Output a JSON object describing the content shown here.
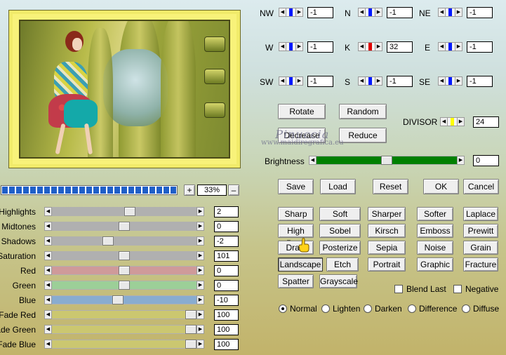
{
  "matrix": {
    "cells": [
      {
        "label": "NW",
        "value": "-1",
        "thumb_color": "#0018ff"
      },
      {
        "label": "N",
        "value": "-1",
        "thumb_color": "#0018ff"
      },
      {
        "label": "NE",
        "value": "-1",
        "thumb_color": "#0018ff"
      },
      {
        "label": "W",
        "value": "-1",
        "thumb_color": "#0018ff"
      },
      {
        "label": "K",
        "value": "32",
        "thumb_color": "#e00000"
      },
      {
        "label": "E",
        "value": "-1",
        "thumb_color": "#0018ff"
      },
      {
        "label": "SW",
        "value": "-1",
        "thumb_color": "#0018ff"
      },
      {
        "label": "S",
        "value": "-1",
        "thumb_color": "#0018ff"
      },
      {
        "label": "SE",
        "value": "-1",
        "thumb_color": "#0018ff"
      }
    ],
    "divisor_label": "DIVISOR",
    "divisor_value": "24",
    "divisor_thumb_color": "#ffff00",
    "rotate": "Rotate",
    "random": "Random",
    "decrease": "Decrease",
    "reduce": "Reduce"
  },
  "brightness": {
    "label": "Brightness",
    "value": "0",
    "level_fraction": 0.5,
    "track_color": "#008000"
  },
  "zoom": {
    "value": "33%",
    "plus": "+",
    "minus": "–",
    "progress_fraction": 1.0
  },
  "actions": {
    "save": "Save",
    "load": "Load",
    "reset": "Reset",
    "ok": "OK",
    "cancel": "Cancel"
  },
  "adjustments": [
    {
      "label": "Highlights",
      "value": "2",
      "level": 0.54,
      "color": "#b0b0b0"
    },
    {
      "label": "Midtones",
      "value": "0",
      "level": 0.5,
      "color": "#b0b0b0"
    },
    {
      "label": "Shadows",
      "value": "-2",
      "level": 0.38,
      "color": "#b0b0b0"
    },
    {
      "label": "Saturation",
      "value": "101",
      "level": 0.5,
      "color": "#b0b0b0"
    },
    {
      "label": "Red",
      "value": "0",
      "level": 0.5,
      "color": "#cf9a9a"
    },
    {
      "label": "Green",
      "value": "0",
      "level": 0.5,
      "color": "#9ccf98"
    },
    {
      "label": "Blue",
      "value": "-10",
      "level": 0.45,
      "color": "#89acd0"
    },
    {
      "label": "Fade Red",
      "value": "100",
      "level": 1.0,
      "color": "#cbc770"
    },
    {
      "label": "Fade Green",
      "value": "100",
      "level": 1.0,
      "color": "#cbc770"
    },
    {
      "label": "Fade Blue",
      "value": "100",
      "level": 1.0,
      "color": "#cbc770"
    }
  ],
  "filters": [
    [
      "Sharp",
      "Soft",
      "Sharper",
      "Softer",
      "Laplace"
    ],
    [
      "High Pass",
      "Sobel",
      "Kirsch",
      "Emboss",
      "Prewitt"
    ],
    [
      "Draw",
      "Posterize",
      "Sepia",
      "Noise",
      "Grain"
    ],
    [
      "Landscape",
      "Etch",
      "Portrait",
      "Graphic",
      "Fracture"
    ],
    [
      "Spatter",
      "Grayscale"
    ]
  ],
  "selected_filter": "Landscape",
  "options": {
    "blend_last": "Blend Last",
    "negative": "Negative"
  },
  "blend_modes": [
    "Normal",
    "Lighten",
    "Darken",
    "Difference",
    "Diffuse"
  ],
  "selected_blend": "Normal",
  "watermark": {
    "line1": "Pinuccia",
    "line2": "www.maidiregrafica.eu"
  },
  "icons": {
    "left_arrow": "left-arrow-icon",
    "right_arrow": "right-arrow-icon",
    "pointer": "hand-pointer-icon"
  }
}
